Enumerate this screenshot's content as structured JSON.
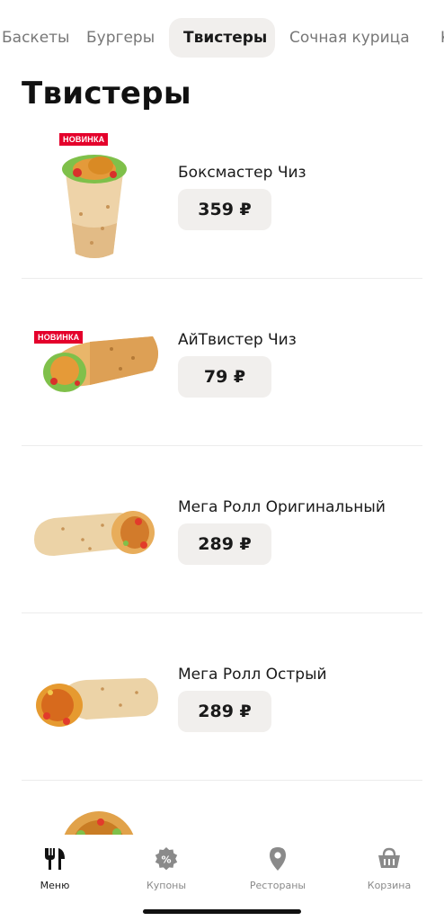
{
  "tabs": [
    {
      "label": "Баскеты"
    },
    {
      "label": "Бургеры"
    },
    {
      "label": "Твистеры"
    },
    {
      "label": "Сочная курица"
    },
    {
      "label": "К"
    }
  ],
  "active_tab": "Твистеры",
  "section_title": "Твистеры",
  "products": [
    {
      "name": "Боксмастер Чиз",
      "price": "359 ₽",
      "badge": "НОВИНКА"
    },
    {
      "name": "АйТвистер Чиз",
      "price": "79 ₽",
      "badge": "НОВИНКА"
    },
    {
      "name": "Мега Ролл Оригинальный",
      "price": "289 ₽"
    },
    {
      "name": "Мега Ролл Острый",
      "price": "289 ₽"
    }
  ],
  "bottom_nav": [
    {
      "label": "Меню",
      "icon": "fork-knife-icon",
      "active": true
    },
    {
      "label": "Купоны",
      "icon": "coupon-icon"
    },
    {
      "label": "Рестораны",
      "icon": "location-pin-icon"
    },
    {
      "label": "Корзина",
      "icon": "basket-icon"
    }
  ],
  "colors": {
    "accent_red": "#e4002b",
    "chip_bg": "#f1efed",
    "text": "#1a1a1a",
    "muted": "#8a8a8a"
  }
}
